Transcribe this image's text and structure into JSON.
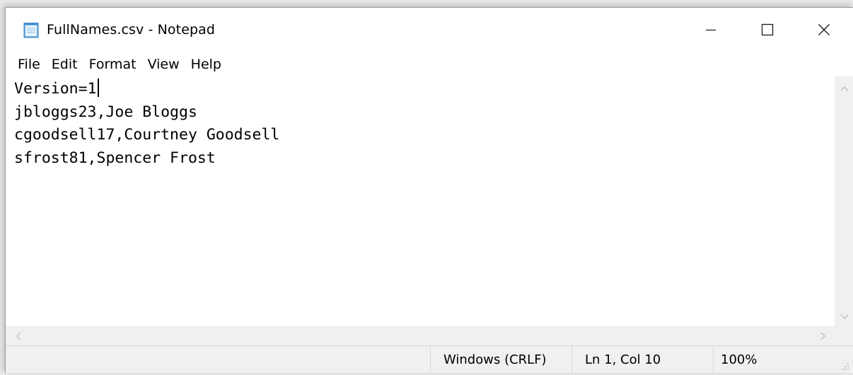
{
  "window": {
    "title": "FullNames.csv - Notepad"
  },
  "menu": [
    "File",
    "Edit",
    "Format",
    "View",
    "Help"
  ],
  "document": {
    "lines": [
      "Version=1",
      "jbloggs23,Joe Bloggs",
      "cgoodsell17,Courtney Goodsell",
      "sfrost81,Spencer Frost"
    ]
  },
  "status": {
    "line_endings": "Windows (CRLF)",
    "position": "Ln 1, Col 10",
    "zoom": "100%"
  },
  "icons": {
    "app": "notepad-icon",
    "minimize": "minimize-icon",
    "maximize": "maximize-icon",
    "close": "close-icon"
  }
}
